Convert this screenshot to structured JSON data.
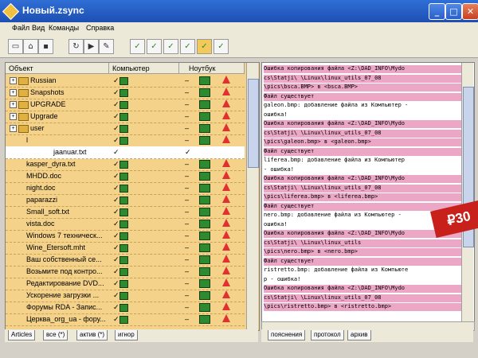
{
  "window": {
    "title": "Новый.zsync",
    "controls": [
      "_",
      "□",
      "✕"
    ]
  },
  "menu": [
    "Файл",
    "Вид",
    "Команды",
    "Справка"
  ],
  "columns": {
    "object": "Объект",
    "computer": "Компьютер",
    "notebook": "Ноутбук"
  },
  "rows": [
    {
      "name": "Russian",
      "folder": true,
      "c1": "✓",
      "c2": "–"
    },
    {
      "name": "Snapshots",
      "folder": true,
      "c1": "✓",
      "c2": "–"
    },
    {
      "name": "UPGRADE",
      "folder": true,
      "c1": "✓",
      "c2": "–"
    },
    {
      "name": "Upgrade",
      "folder": true,
      "c1": "✓",
      "c2": "–"
    },
    {
      "name": "user",
      "folder": true,
      "c1": "✓",
      "c2": "–"
    },
    {
      "name": "l",
      "folder": false,
      "c1": "✓",
      "c2": "–"
    },
    {
      "name": "jaanuar.txt",
      "folder": false,
      "selected": true,
      "c1": "✓",
      "c2": "✓"
    },
    {
      "name": "kasper_dyra.txt",
      "folder": false,
      "c1": "✓",
      "c2": "–"
    },
    {
      "name": "MHDD.doc",
      "folder": false,
      "c1": "✓",
      "c2": "–"
    },
    {
      "name": "night.doc",
      "folder": false,
      "c1": "✓",
      "c2": "–"
    },
    {
      "name": "paparazzi",
      "folder": false,
      "c1": "✓",
      "c2": "–"
    },
    {
      "name": "Small_soft.txt",
      "folder": false,
      "c1": "✓",
      "c2": "–"
    },
    {
      "name": "vista.doc",
      "folder": false,
      "c1": "✓",
      "c2": "–"
    },
    {
      "name": "Windows 7 техническ...",
      "folder": false,
      "c1": "✓",
      "c2": "–"
    },
    {
      "name": "Wine_Etersoft.mht",
      "folder": false,
      "c1": "✓",
      "c2": "–"
    },
    {
      "name": "Ваш собственный се...",
      "folder": false,
      "c1": "✓",
      "c2": "–"
    },
    {
      "name": "Возьмите под контро...",
      "folder": false,
      "c1": "✓",
      "c2": "–"
    },
    {
      "name": "Редактирование DVD...",
      "folder": false,
      "c1": "✓",
      "c2": "–"
    },
    {
      "name": "Ускорение загрузки ...",
      "folder": false,
      "c1": "✓",
      "c2": "–"
    },
    {
      "name": "Форумы RDA - Запис...",
      "folder": false,
      "c1": "✓",
      "c2": "–"
    },
    {
      "name": "Церква_org_ua - фору...",
      "folder": false,
      "c1": "✓",
      "c2": "–"
    }
  ],
  "left_tabs": [
    "Articles",
    "все (*)",
    "актив (*)",
    "игнор"
  ],
  "log": [
    {
      "text": "  Ошибка копирования файла <Z:\\DAD_INFO\\Mydo",
      "pink": true
    },
    {
      "text": "cs\\Statji\\          \\Linux\\linux_utils_07_08",
      "pink": true
    },
    {
      "text": "\\pics\\bsca.BMP> в <bsca.BMP>",
      "pink": true
    },
    {
      "text": "Файл существует",
      "pink": true
    },
    {
      "text": "galeon.bmp: добавление файла из Компьютер -",
      "pink": false
    },
    {
      "text": " ошибка!",
      "pink": false
    },
    {
      "text": "  Ошибка копирования файла <Z:\\DAD_INFO\\Mydo",
      "pink": true
    },
    {
      "text": "cs\\Statji\\          \\Linux\\linux_utils_07_08",
      "pink": true
    },
    {
      "text": "\\pics\\galeon.bmp> в <galeon.bmp>",
      "pink": true
    },
    {
      "text": "Файл существует",
      "pink": true
    },
    {
      "text": "liferea.bmp: добавление файла из Компьютер",
      "pink": false
    },
    {
      "text": " - ошибка!",
      "pink": false
    },
    {
      "text": "  Ошибка копирования файла <Z:\\DAD_INFO\\Mydo",
      "pink": true
    },
    {
      "text": "cs\\Statji\\          \\Linux\\linux_utils_07_08",
      "pink": true
    },
    {
      "text": "\\pics\\liferea.bmp> в <liferea.bmp>",
      "pink": true
    },
    {
      "text": "Файл существует",
      "pink": true
    },
    {
      "text": "nero.bmp: добавление файла из Компьютер -",
      "pink": false
    },
    {
      "text": "ошибка!",
      "pink": false
    },
    {
      "text": "  Ошибка копирования файла <Z:\\DAD_INFO\\Mydo",
      "pink": true
    },
    {
      "text": "cs\\Statji\\          \\Linux\\linux_utils",
      "pink": true
    },
    {
      "text": "\\pics\\nero.bmp> в <nero.bmp>",
      "pink": true
    },
    {
      "text": "Файл существует",
      "pink": true
    },
    {
      "text": "ristretto.bmp: добавление файла из Компьюте",
      "pink": false
    },
    {
      "text": "р - ошибка!",
      "pink": false
    },
    {
      "text": "  Ошибка копирования файла <Z:\\DAD_INFO\\Mydo",
      "pink": true
    },
    {
      "text": "cs\\Statji\\          \\Linux\\linux_utils_07_08",
      "pink": true
    },
    {
      "text": "\\pics\\ristretto.bmp> в <ristretto.bmp>",
      "pink": true
    }
  ],
  "right_tabs": [
    "пояснения",
    "протокол",
    "архив"
  ],
  "badge": "₽30",
  "colors": {
    "row_bg": "#f5d28a",
    "log_highlight": "#eca6c6",
    "titlebar": "#2f6fd6"
  }
}
